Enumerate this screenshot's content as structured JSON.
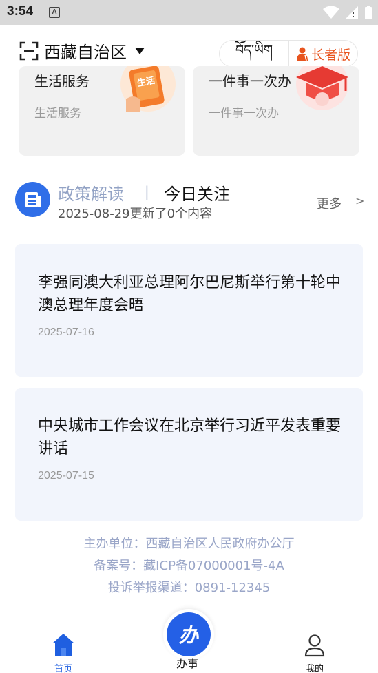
{
  "status_bar": {
    "time": "3:54",
    "notification": "A"
  },
  "header": {
    "region": "西藏自治区",
    "tibetan_label": "བོད་ཡིག",
    "elder_label": "长者版"
  },
  "services": [
    {
      "title": "生活服务",
      "subtitle": "生活服务",
      "badge": "生活"
    },
    {
      "title": "一件事一次办",
      "subtitle": "一件事一次办"
    }
  ],
  "policy": {
    "tab_inactive": "政策解读",
    "separator": "|",
    "tab_active": "今日关注",
    "updated": "2025-08-29更新了0个内容",
    "more": "更多",
    "more_arrow": ">"
  },
  "news": [
    {
      "title": "李强同澳大利亚总理阿尔巴尼斯举行第十轮中澳总理年度会晤",
      "date": "2025-07-16"
    },
    {
      "title": "中央城市工作会议在北京举行习近平发表重要讲话",
      "date": "2025-07-15"
    }
  ],
  "footer": {
    "sponsor": "主办单位：西藏自治区人民政府办公厅",
    "icp": "备案号：藏ICP备07000001号-4A",
    "complaint": "投诉举报渠道：0891-12345"
  },
  "bottom_nav": {
    "home": "首页",
    "center_glyph": "办",
    "center_label": "办事",
    "me": "我的"
  },
  "colors": {
    "accent": "#2460e6",
    "elder": "#e8541e",
    "footer_text": "#9aa6c8"
  }
}
